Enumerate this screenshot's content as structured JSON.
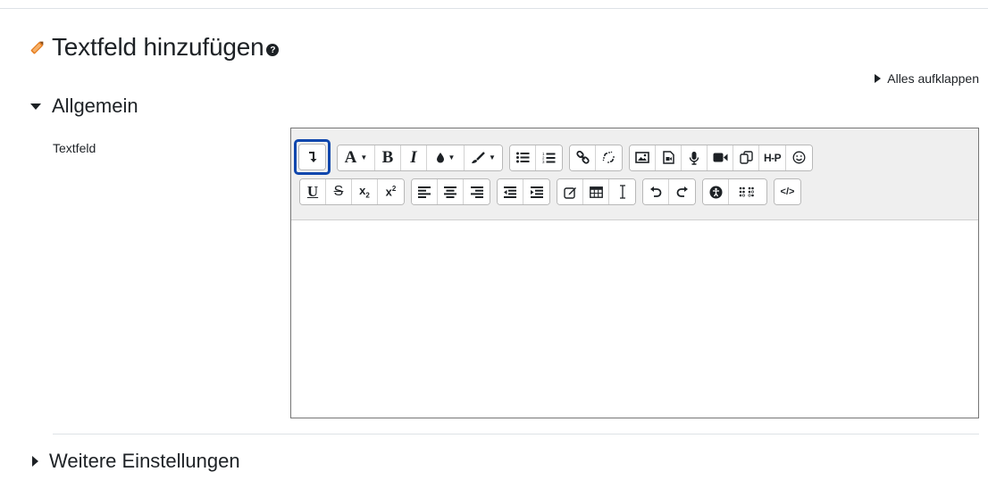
{
  "page": {
    "title": "Textfeld hinzufügen",
    "help_symbol": "?",
    "expand_all_label": "Alles aufklappen"
  },
  "sections": {
    "general": {
      "label": "Allgemein",
      "expanded": true
    },
    "more": {
      "label": "Weitere Einstellungen",
      "expanded": false
    }
  },
  "field": {
    "label": "Textfeld"
  },
  "toolbar": {
    "row1": [
      {
        "name": "show-more-buttons",
        "icon": "toggle-more-icon",
        "focused": true
      },
      {
        "name": "font-style-dropdown",
        "icon": "font-letter-icon",
        "text": "A"
      },
      {
        "name": "bold-button",
        "icon": "bold-icon",
        "text": "B"
      },
      {
        "name": "italic-button",
        "icon": "italic-icon",
        "text": "I"
      },
      {
        "name": "font-color-dropdown",
        "icon": "droplet-icon"
      },
      {
        "name": "background-color-dropdown",
        "icon": "paintbrush-icon"
      },
      {
        "name": "unordered-list-button",
        "icon": "bullet-list-icon"
      },
      {
        "name": "ordered-list-button",
        "icon": "numbered-list-icon"
      },
      {
        "name": "link-button",
        "icon": "link-icon"
      },
      {
        "name": "unlink-button",
        "icon": "unlink-icon"
      },
      {
        "name": "image-button",
        "icon": "image-icon"
      },
      {
        "name": "media-button",
        "icon": "media-file-icon"
      },
      {
        "name": "record-audio-button",
        "icon": "microphone-icon"
      },
      {
        "name": "record-video-button",
        "icon": "video-camera-icon"
      },
      {
        "name": "manage-files-button",
        "icon": "files-icon"
      },
      {
        "name": "h5p-button",
        "icon": "h5p-icon",
        "text": "H-P"
      },
      {
        "name": "emoji-button",
        "icon": "smiley-icon"
      }
    ],
    "row2": [
      {
        "name": "underline-button",
        "icon": "underline-icon",
        "text": "U"
      },
      {
        "name": "strikethrough-button",
        "icon": "strikethrough-icon",
        "text": "S"
      },
      {
        "name": "subscript-button",
        "icon": "subscript-icon",
        "text": "x",
        "sub": "2"
      },
      {
        "name": "superscript-button",
        "icon": "superscript-icon",
        "text": "x",
        "sup": "2"
      },
      {
        "name": "align-left-button",
        "icon": "align-left-icon"
      },
      {
        "name": "align-center-button",
        "icon": "align-center-icon"
      },
      {
        "name": "align-right-button",
        "icon": "align-right-icon"
      },
      {
        "name": "outdent-button",
        "icon": "outdent-icon"
      },
      {
        "name": "indent-button",
        "icon": "indent-icon"
      },
      {
        "name": "equation-button",
        "icon": "pencil-square-icon"
      },
      {
        "name": "table-button",
        "icon": "table-icon"
      },
      {
        "name": "clear-formatting-button",
        "icon": "text-cursor-icon"
      },
      {
        "name": "undo-button",
        "icon": "undo-icon"
      },
      {
        "name": "redo-button",
        "icon": "redo-icon"
      },
      {
        "name": "accessibility-checker-button",
        "icon": "accessibility-icon"
      },
      {
        "name": "screenreader-helper-button",
        "icon": "braille-icon"
      },
      {
        "name": "html-source-button",
        "icon": "code-icon",
        "text": "</>"
      }
    ]
  },
  "colors": {
    "focus_ring": "#0f47ad",
    "text": "#1d2125",
    "toolbar_bg": "#efefef",
    "title_icon": "#e57a1a"
  }
}
